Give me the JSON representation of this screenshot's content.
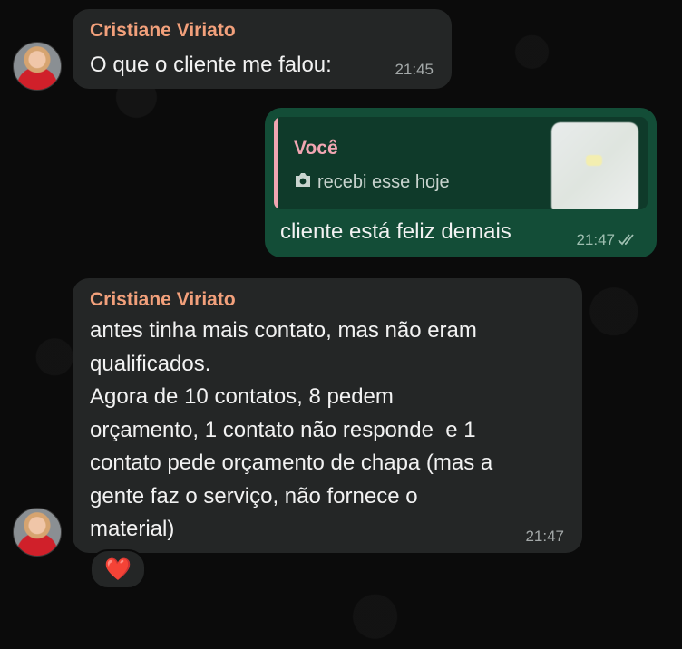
{
  "messages": [
    {
      "sender": "Cristiane Viriato",
      "text": "O que o cliente me falou:",
      "time": "21:45"
    },
    {
      "quote_author": "Você",
      "quote_text": "recebi esse hoje",
      "text": "cliente está feliz demais",
      "time": "21:47",
      "status_icon": "double-check-icon"
    },
    {
      "sender": "Cristiane Viriato",
      "lines": [
        "antes tinha mais contato, mas não eram",
        "qualificados.",
        "Agora de 10 contatos, 8 pedem",
        "orçamento, 1 contato não responde  e 1",
        "contato pede orçamento de chapa (mas a",
        "gente faz o serviço, não fornece o",
        "material)"
      ],
      "time": "21:47",
      "reaction": "❤️"
    }
  ],
  "colors": {
    "incoming_bubble": "#242626",
    "outgoing_bubble": "#134d37",
    "sender_name": "#f2a07b",
    "quote_accent": "#f1a6b2"
  }
}
